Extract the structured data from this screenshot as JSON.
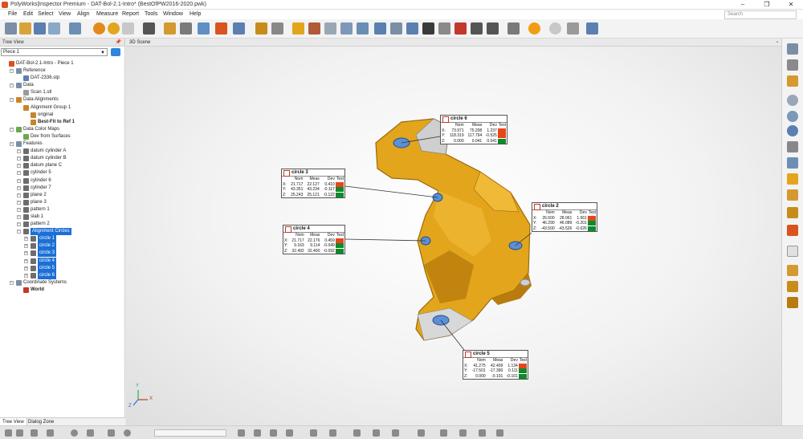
{
  "window": {
    "title": "PolyWorks|Inspector Premium - DAT-Bol-2.1-Intro* (BestOfPW2016-2020.pwk)",
    "min": "–",
    "max": "❐",
    "close": "✕"
  },
  "menu": [
    "File",
    "Edit",
    "Select",
    "View",
    "Align",
    "Measure",
    "Report",
    "Tools",
    "Window",
    "Help"
  ],
  "search_placeholder": "Search",
  "tree_panel": {
    "header": "Tree View",
    "pin": "📌",
    "piece": "Piece 1",
    "items": [
      {
        "label": "DAT-Bol-2.1-Intro - Piece 1",
        "level": 0,
        "icon": "project-icon",
        "color": "#d9531e",
        "sel": false,
        "bold": false
      },
      {
        "label": "Reference",
        "level": 1,
        "icon": "reference-folder-icon",
        "color": "#7a8fa6",
        "sel": false,
        "bold": false
      },
      {
        "label": "DAT-2336.stp",
        "level": 2,
        "icon": "cad-model-icon",
        "color": "#5b7fb0",
        "sel": false,
        "bold": false
      },
      {
        "label": "Data",
        "level": 1,
        "icon": "data-folder-icon",
        "color": "#7a8fa6",
        "sel": false,
        "bold": false
      },
      {
        "label": "Scan 1.stl",
        "level": 2,
        "icon": "scan-icon",
        "color": "#9a9a9a",
        "sel": false,
        "bold": false
      },
      {
        "label": "Data Alignments",
        "level": 1,
        "icon": "alignment-folder-icon",
        "color": "#c7852a",
        "sel": false,
        "bold": false
      },
      {
        "label": "Alignment Group 1",
        "level": 2,
        "icon": "alignment-group-icon",
        "color": "#c7852a",
        "sel": false,
        "bold": false
      },
      {
        "label": "original",
        "level": 3,
        "icon": "alignment-icon",
        "color": "#c7852a",
        "sel": false,
        "bold": false
      },
      {
        "label": "Best-Fit to Ref 1",
        "level": 3,
        "icon": "best-fit-icon",
        "color": "#c7852a",
        "sel": false,
        "bold": true
      },
      {
        "label": "Data Color Maps",
        "level": 1,
        "icon": "color-map-folder-icon",
        "color": "#6aa84f",
        "sel": false,
        "bold": false
      },
      {
        "label": "Dev from Surfaces",
        "level": 2,
        "icon": "color-map-icon",
        "color": "#6aa84f",
        "sel": false,
        "bold": false
      },
      {
        "label": "Features",
        "level": 1,
        "icon": "features-folder-icon",
        "color": "#7a8fa6",
        "sel": false,
        "bold": false
      },
      {
        "label": "datum cylinder A",
        "level": 2,
        "icon": "cylinder-icon",
        "color": "#6d6d6d",
        "sel": false,
        "bold": false
      },
      {
        "label": "datum cylinder B",
        "level": 2,
        "icon": "cylinder-icon",
        "color": "#6d6d6d",
        "sel": false,
        "bold": false
      },
      {
        "label": "datum plane C",
        "level": 2,
        "icon": "plane-icon",
        "color": "#6d6d6d",
        "sel": false,
        "bold": false
      },
      {
        "label": "cylinder 5",
        "level": 2,
        "icon": "cylinder-icon",
        "color": "#6d6d6d",
        "sel": false,
        "bold": false
      },
      {
        "label": "cylinder 6",
        "level": 2,
        "icon": "cylinder-icon",
        "color": "#6d6d6d",
        "sel": false,
        "bold": false
      },
      {
        "label": "cylinder 7",
        "level": 2,
        "icon": "cylinder-icon",
        "color": "#6d6d6d",
        "sel": false,
        "bold": false
      },
      {
        "label": "plane 2",
        "level": 2,
        "icon": "plane-icon",
        "color": "#6d6d6d",
        "sel": false,
        "bold": false
      },
      {
        "label": "plane 3",
        "level": 2,
        "icon": "plane-icon",
        "color": "#6d6d6d",
        "sel": false,
        "bold": false
      },
      {
        "label": "pattern 1",
        "level": 2,
        "icon": "pattern-icon",
        "color": "#6d6d6d",
        "sel": false,
        "bold": false
      },
      {
        "label": "slab 1",
        "level": 2,
        "icon": "slab-icon",
        "color": "#6d6d6d",
        "sel": false,
        "bold": false
      },
      {
        "label": "pattern 2",
        "level": 2,
        "icon": "pattern-icon",
        "color": "#6d6d6d",
        "sel": false,
        "bold": false
      },
      {
        "label": "Alignment Circles",
        "level": 2,
        "icon": "group-icon",
        "color": "#6d6d6d",
        "sel": true,
        "bold": false
      },
      {
        "label": "circle 1",
        "level": 3,
        "icon": "circle-icon",
        "color": "#6d6d6d",
        "sel": true,
        "bold": false
      },
      {
        "label": "circle 2",
        "level": 3,
        "icon": "circle-icon",
        "color": "#6d6d6d",
        "sel": true,
        "bold": false
      },
      {
        "label": "circle 3",
        "level": 3,
        "icon": "circle-icon",
        "color": "#6d6d6d",
        "sel": true,
        "bold": false
      },
      {
        "label": "circle 4",
        "level": 3,
        "icon": "circle-icon",
        "color": "#6d6d6d",
        "sel": true,
        "bold": false
      },
      {
        "label": "circle 5",
        "level": 3,
        "icon": "circle-icon",
        "color": "#6d6d6d",
        "sel": true,
        "bold": false
      },
      {
        "label": "circle 6",
        "level": 3,
        "icon": "circle-icon",
        "color": "#6d6d6d",
        "sel": true,
        "bold": false
      },
      {
        "label": "Coordinate Systems",
        "level": 1,
        "icon": "coordinate-systems-icon",
        "color": "#7a8fa6",
        "sel": false,
        "bold": false
      },
      {
        "label": "World",
        "level": 2,
        "icon": "world-axes-icon",
        "color": "#c0392b",
        "sel": false,
        "bold": true
      }
    ],
    "bottom_tabs": [
      "Tree View",
      "Dialog Zone"
    ]
  },
  "scene": {
    "header": "3D Scene"
  },
  "callout_cols": [
    "",
    "Nom",
    "Meas",
    "Dev",
    "Test"
  ],
  "callouts": [
    {
      "name": "circle 6",
      "rows": [
        {
          "axis": "X:",
          "nom": "73.971",
          "meas": "75.208",
          "dev": "1.237",
          "test": "fail"
        },
        {
          "axis": "Y:",
          "nom": "118.319",
          "meas": "117.794",
          "dev": "-0.525",
          "test": "fail"
        },
        {
          "axis": "Z:",
          "nom": "0.000",
          "meas": "0.041",
          "dev": "0.041",
          "test": "pass"
        }
      ]
    },
    {
      "name": "circle 3",
      "rows": [
        {
          "axis": "X:",
          "nom": "21.717",
          "meas": "22.127",
          "dev": "0.410",
          "test": "fail"
        },
        {
          "axis": "Y:",
          "nom": "43.351",
          "meas": "43.234",
          "dev": "-0.117",
          "test": "pass"
        },
        {
          "axis": "Z:",
          "nom": "25.243",
          "meas": "25.121",
          "dev": "-0.122",
          "test": "pass"
        }
      ]
    },
    {
      "name": "circle 2",
      "rows": [
        {
          "axis": "X:",
          "nom": "26.500",
          "meas": "28.061",
          "dev": "1.561",
          "test": "fail"
        },
        {
          "axis": "Y:",
          "nom": "46.290",
          "meas": "46.089",
          "dev": "-0.201",
          "test": "pass"
        },
        {
          "axis": "Z:",
          "nom": "-43.500",
          "meas": "-43.526",
          "dev": "-0.026",
          "test": "pass"
        }
      ]
    },
    {
      "name": "circle 4",
      "rows": [
        {
          "axis": "X:",
          "nom": "21.717",
          "meas": "22.176",
          "dev": "0.459",
          "test": "fail"
        },
        {
          "axis": "Y:",
          "nom": "9.163",
          "meas": "9.114",
          "dev": "-0.049",
          "test": "pass"
        },
        {
          "axis": "Z:",
          "nom": "32.492",
          "meas": "32.400",
          "dev": "-0.092",
          "test": "pass"
        }
      ]
    },
    {
      "name": "circle 5",
      "rows": [
        {
          "axis": "X:",
          "nom": "41.275",
          "meas": "42.409",
          "dev": "1.134",
          "test": "fail"
        },
        {
          "axis": "Y:",
          "nom": "-17.501",
          "meas": "-17.390",
          "dev": "0.111",
          "test": "pass"
        },
        {
          "axis": "Z:",
          "nom": "0.000",
          "meas": "-0.101",
          "dev": "-0.101",
          "test": "pass"
        }
      ]
    }
  ],
  "axis_triad": {
    "x": "X",
    "y": "Y",
    "z": "Z"
  },
  "colors": {
    "part": "#e3a51c",
    "part_shadow": "#b77c0d",
    "fail": "#e8451d",
    "pass": "#0f8a2a",
    "selection": "#1b6fd6"
  }
}
